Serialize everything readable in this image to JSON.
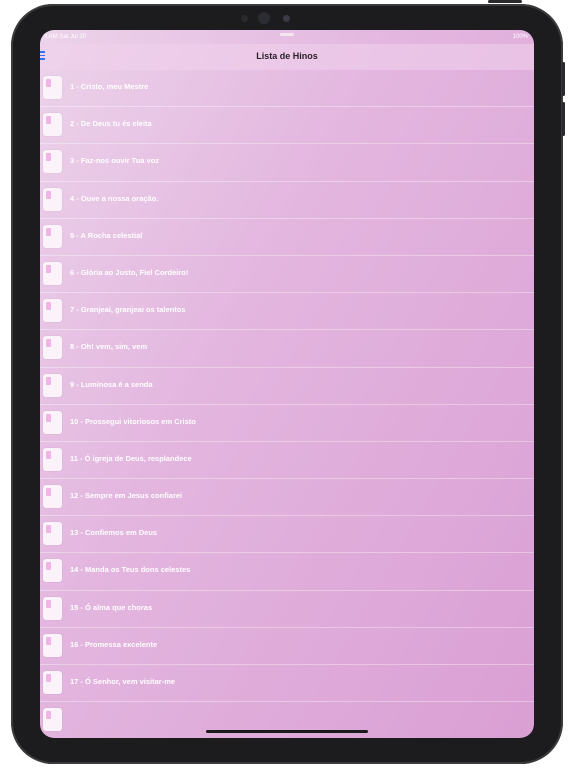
{
  "status_bar": {
    "time_date": "9 AM   Sat Jul 20",
    "battery": "100%"
  },
  "nav": {
    "title": "Lista de Hinos",
    "menu_icon": "hamburger-menu-icon"
  },
  "colors": {
    "accent": "#2f74e8",
    "background_start": "#ecd3ea",
    "background_end": "#da9fd4",
    "text": "#ffffff"
  },
  "hymns": [
    {
      "label": "1 - Cristo, meu Mestre"
    },
    {
      "label": "2 - De Deus tu és eleita"
    },
    {
      "label": "3 - Faz-nos ouvir Tua voz"
    },
    {
      "label": "4 - Ouve a nossa oração."
    },
    {
      "label": "5 - A Rocha celestial"
    },
    {
      "label": "6 - Glória ao Justo, Fiel Cordeiro!"
    },
    {
      "label": "7 - Granjeai, granjeai os talentos"
    },
    {
      "label": "8 - Oh! vem, sim, vem"
    },
    {
      "label": "9 - Luminosa é a senda"
    },
    {
      "label": "10 - Prossegui vitoriosos em Cristo"
    },
    {
      "label": "11 - Ó igreja de Deus, resplandece"
    },
    {
      "label": "12 - Sempre em Jesus confiarei"
    },
    {
      "label": "13 - Confiemos em Deus"
    },
    {
      "label": "14 - Manda os Teus dons celestes"
    },
    {
      "label": "15 - Ó alma que choras"
    },
    {
      "label": "16 - Promessa excelente"
    },
    {
      "label": "17 - Ó Senhor, vem visitar-me"
    },
    {
      "label": ""
    }
  ]
}
